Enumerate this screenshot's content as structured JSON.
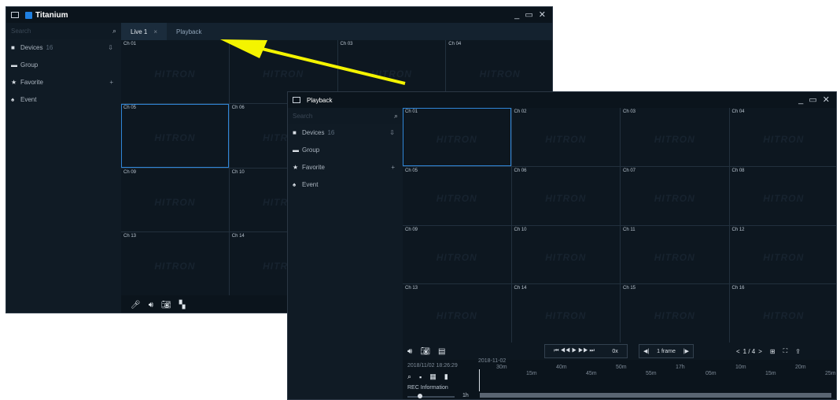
{
  "live_window": {
    "title": "Titanium",
    "window_controls": "_ ▭ ✕",
    "search_placeholder": "Search",
    "sidebar": [
      {
        "label": "Devices",
        "count": "16",
        "icon": "camera-icon",
        "action": "⇩"
      },
      {
        "label": "Group",
        "count": "",
        "icon": "folder-icon",
        "action": ""
      },
      {
        "label": "Favorite",
        "count": "",
        "icon": "star-icon",
        "action": "+"
      },
      {
        "label": "Event",
        "count": "",
        "icon": "bell-icon",
        "action": ""
      }
    ],
    "tabs": [
      {
        "label": "Live 1",
        "close": "×"
      },
      {
        "label": "Playback",
        "close": ""
      }
    ],
    "channels": [
      "Ch 01",
      "",
      "Ch 03",
      "Ch 04",
      "Ch 05",
      "Ch 06",
      "",
      "",
      "Ch 09",
      "Ch 10",
      "",
      "",
      "Ch 13",
      "Ch 14",
      "",
      ""
    ],
    "watermark": "HITRON",
    "toolbar_icons": [
      "microphone-icon",
      "speaker-icon",
      "camera-icon",
      "layout-icon"
    ]
  },
  "playback_window": {
    "title": "Playback",
    "window_controls": "_ ▭ ✕",
    "search_placeholder": "Search",
    "sidebar": [
      {
        "label": "Devices",
        "count": "16",
        "icon": "camera-icon",
        "action": "⇩"
      },
      {
        "label": "Group",
        "count": "",
        "icon": "folder-icon",
        "action": ""
      },
      {
        "label": "Favorite",
        "count": "",
        "icon": "star-icon",
        "action": "+"
      },
      {
        "label": "Event",
        "count": "",
        "icon": "bell-icon",
        "action": ""
      }
    ],
    "channels": [
      "Ch 01",
      "Ch 02",
      "Ch 03",
      "Ch 04",
      "Ch 05",
      "Ch 06",
      "Ch 07",
      "Ch 08",
      "Ch 09",
      "Ch 10",
      "Ch 11",
      "Ch 12",
      "Ch 13",
      "Ch 14",
      "Ch 15",
      "Ch 16"
    ],
    "watermark": "HITRON",
    "playback_controls": "⏮ ◀◀ ▶ ▶▶ ⏭",
    "speed": "0x",
    "frame_label": "1 frame",
    "page_indicator": "1 / 4",
    "date_time": "2018/11/02   18:26:29",
    "timeline_date": "2018-11-02",
    "timeline_ticks": [
      "30m",
      "15m",
      "40m",
      "45m",
      "50m",
      "55m",
      "17h",
      "05m",
      "10m",
      "15m",
      "20m",
      "25m"
    ],
    "rec_info": "REC Information",
    "zoom_label": "1h"
  },
  "accent": "#2f86d8",
  "arrow_color": "#f4f400"
}
